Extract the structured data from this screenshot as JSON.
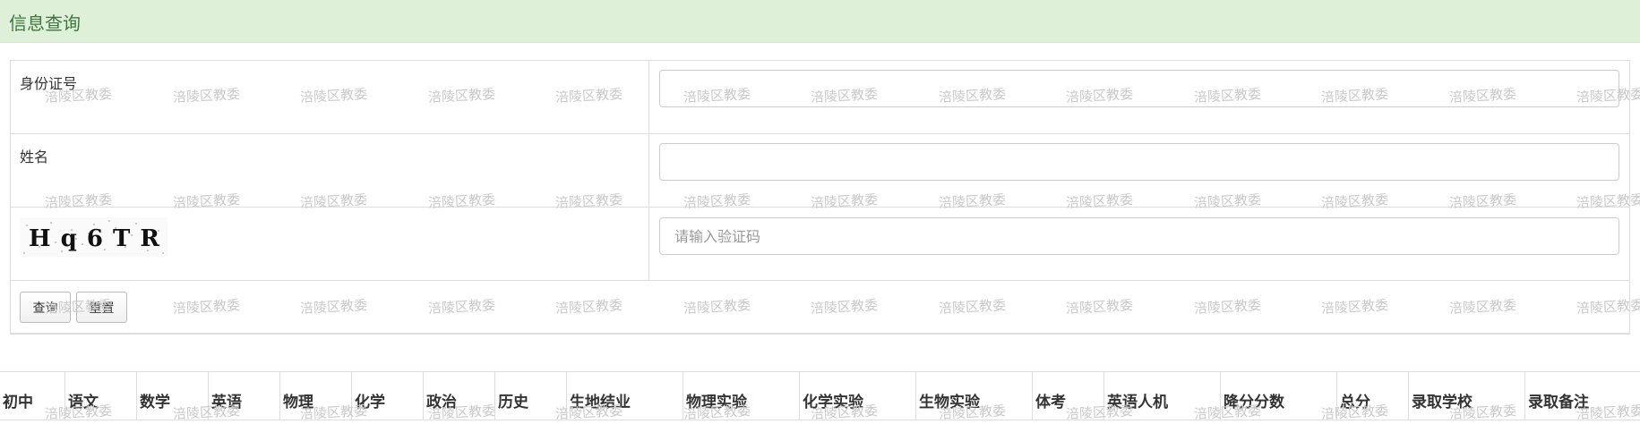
{
  "header": {
    "title": "信息查询"
  },
  "form": {
    "id_label": "身份证号",
    "name_label": "姓名",
    "captcha_text": "H q 6 T R",
    "captcha_placeholder": "请输入验证码",
    "query_button": "查询",
    "reset_button": "重置"
  },
  "results": {
    "columns": [
      "初中",
      "语文",
      "数学",
      "英语",
      "物理",
      "化学",
      "政治",
      "历史",
      "生地结业",
      "物理实验",
      "化学实验",
      "生物实验",
      "体考",
      "英语人机",
      "降分分数",
      "总分",
      "录取学校",
      "录取备注"
    ]
  },
  "watermark": {
    "text": "涪陵区教委"
  },
  "colors": {
    "header_bg": "#dff0d8",
    "header_text": "#3c763d",
    "border": "#dddddd",
    "watermark": "#c9c9c9"
  }
}
